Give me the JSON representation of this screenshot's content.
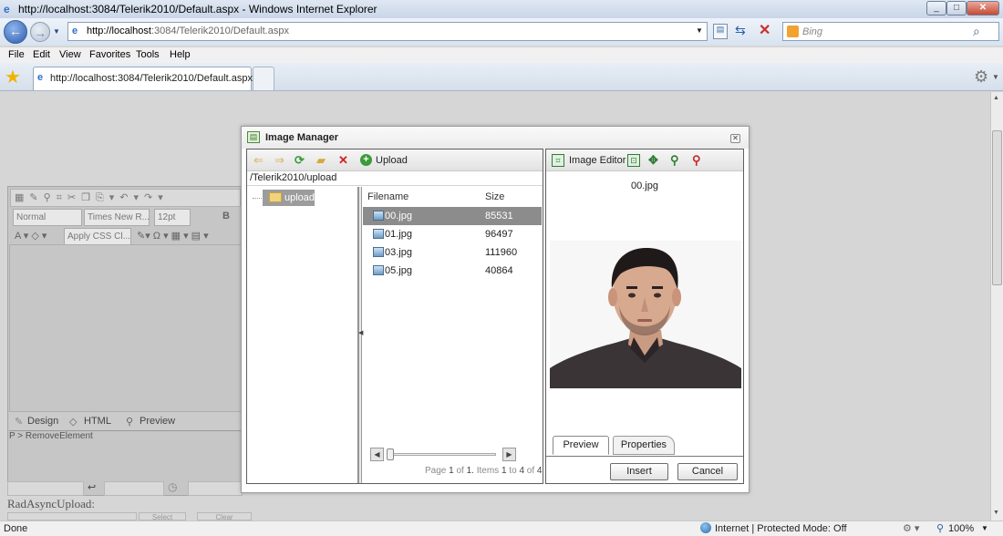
{
  "browser": {
    "window_title": "http://localhost:3084/Telerik2010/Default.aspx - Windows Internet Explorer",
    "address_host": "http://localhost",
    "address_rest": ":3084/Telerik2010/Default.aspx",
    "search_placeholder": "Bing",
    "menu": [
      "File",
      "Edit",
      "View",
      "Favorites",
      "Tools",
      "Help"
    ],
    "tab_title": "http://localhost:3084/Telerik2010/Default.aspx",
    "status_left": "Done",
    "status_zone": "Internet | Protected Mode: Off",
    "zoom": "100%"
  },
  "editor": {
    "format_select": "Normal",
    "font_select": "Times New R...",
    "size_select": "12pt",
    "css_select": "Apply CSS Cl...",
    "modes": [
      "Design",
      "HTML",
      "Preview"
    ],
    "path": "P > RemoveElement",
    "upload_label": "RadAsyncUpload:",
    "select_button": "Select",
    "clear_button": "Clear"
  },
  "dialog": {
    "title": "Image Manager",
    "upload_button": "Upload",
    "current_path": "/Telerik2010/upload",
    "folder": "upload",
    "columns": {
      "filename": "Filename",
      "size": "Size"
    },
    "files": [
      {
        "name": "00.jpg",
        "size": "85531",
        "selected": true
      },
      {
        "name": "01.jpg",
        "size": "96497",
        "selected": false
      },
      {
        "name": "03.jpg",
        "size": "111960",
        "selected": false
      },
      {
        "name": "05.jpg",
        "size": "40864",
        "selected": false
      }
    ],
    "pager": {
      "page_word": "Page",
      "page": "1",
      "of_word": "of",
      "pages": "1.",
      "items_word": "Items",
      "from": "1",
      "to_word": "to",
      "to": "4",
      "of2_word": "of",
      "total": "4"
    },
    "image_editor_button": "Image Editor",
    "preview_filename": "00.jpg",
    "tabs": [
      "Preview",
      "Properties"
    ],
    "insert_button": "Insert",
    "cancel_button": "Cancel"
  }
}
